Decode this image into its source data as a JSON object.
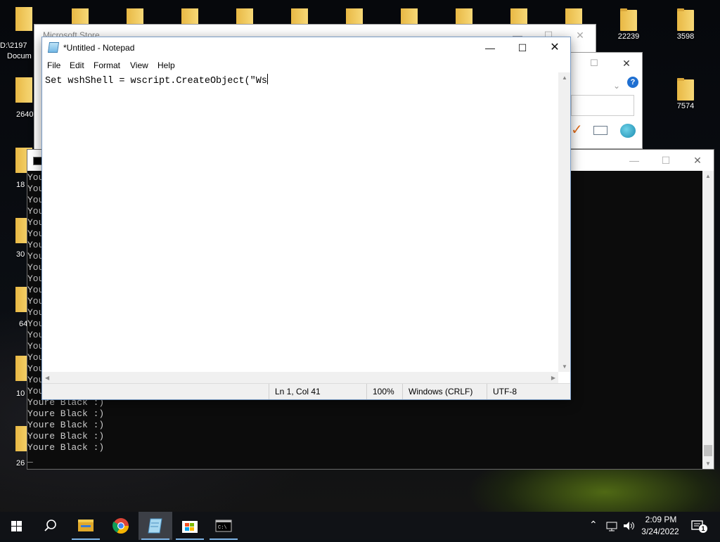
{
  "desktop": {
    "icons_right": [
      {
        "label": "22239"
      },
      {
        "label": "3598"
      },
      {
        "label": "7574"
      }
    ],
    "icons_left_partial": [
      {
        "label": "D:\\2197"
      },
      {
        "label": "Docum"
      },
      {
        "label": "2640"
      },
      {
        "label": "18"
      },
      {
        "label": "30"
      },
      {
        "label": "64"
      },
      {
        "label": "10"
      },
      {
        "label": "26"
      }
    ]
  },
  "store_window": {
    "title": "Microsoft Store"
  },
  "notepad": {
    "title": "*Untitled - Notepad",
    "menu": [
      "File",
      "Edit",
      "Format",
      "View",
      "Help"
    ],
    "content": "Set wshShell = wscript.CreateObject(\"Ws",
    "status": {
      "position": "Ln 1, Col 41",
      "zoom": "100%",
      "line_ending": "Windows (CRLF)",
      "encoding": "UTF-8"
    }
  },
  "console": {
    "hidden_line_prefix": "You",
    "visible_lines": [
      "Youre Black :)",
      "Youre Black :)",
      "Youre Black :)",
      "Youre Black :)",
      "Youre Black :)"
    ],
    "cursor": "_"
  },
  "taskbar": {
    "time": "2:09 PM",
    "date": "3/24/2022",
    "notification_count": "1",
    "apps": [
      "file-explorer",
      "chrome",
      "notepad",
      "microsoft-store",
      "command-prompt"
    ]
  },
  "colors": {
    "taskbar_bg": "#101216",
    "accent": "#7fb6e8",
    "folder": "#f7d877"
  }
}
